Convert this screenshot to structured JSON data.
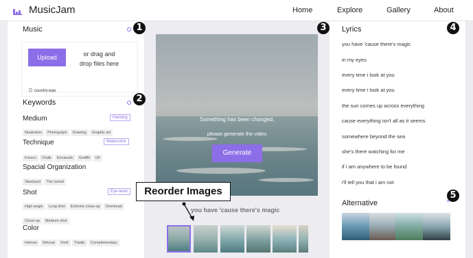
{
  "app": {
    "brand": "MusicJam"
  },
  "nav": {
    "home": "Home",
    "explore": "Explore",
    "gallery": "Gallery",
    "about": "About"
  },
  "music": {
    "title": "Music",
    "upload_label": "Upload",
    "drop_hint_1": "or drag and",
    "drop_hint_2": "drop files here",
    "file_name": "country.wav"
  },
  "keywords": {
    "title": "Keywords",
    "medium": {
      "title": "Medium",
      "selected": "Painting",
      "options": [
        "Illustration",
        "Photograph",
        "Drawing",
        "Graphic art"
      ]
    },
    "technique": {
      "title": "Technique",
      "selected": "Watercolor",
      "options": [
        "Fresco",
        "Chalk",
        "Encaustic",
        "Graffiti",
        "Oil"
      ]
    },
    "spacial": {
      "title": "Spacial Organization",
      "options": [
        "Steelyard",
        "The tunnel"
      ]
    },
    "shot": {
      "title": "Shot",
      "selected": "Eye-level",
      "options": [
        "High-angle",
        "Long shot",
        "Extreme close-up",
        "Overhead",
        "Close-up",
        "Medium shot"
      ]
    },
    "color": {
      "title": "Color",
      "options": [
        "Intense",
        "Netural",
        "Vivid",
        "Triadic",
        "Complementary"
      ]
    }
  },
  "canvas": {
    "message_1": "Something has been changed,",
    "message_2": "please generate the video",
    "generate_label": "Generate",
    "caption": "you have 'cause there's magic",
    "reorder_label": "Reorder Images"
  },
  "lyrics": {
    "title": "Lyrics",
    "lines": [
      "you have 'cause there's magic",
      "in my eyes",
      "every time i look at you",
      "every time i look at you",
      "the sun comes up across everything",
      "cause everything isn't all as it seems",
      "somewhere beyond the sea",
      "she's there watching for me",
      "if i am anywhere to be found",
      "i'll tell you that i am not"
    ]
  },
  "alternative": {
    "title": "Alternative",
    "add_icon": "+"
  },
  "annotations": [
    "1",
    "2",
    "3",
    "4",
    "5"
  ],
  "colors": {
    "accent": "#8c6ee8",
    "background": "#ececf1"
  }
}
